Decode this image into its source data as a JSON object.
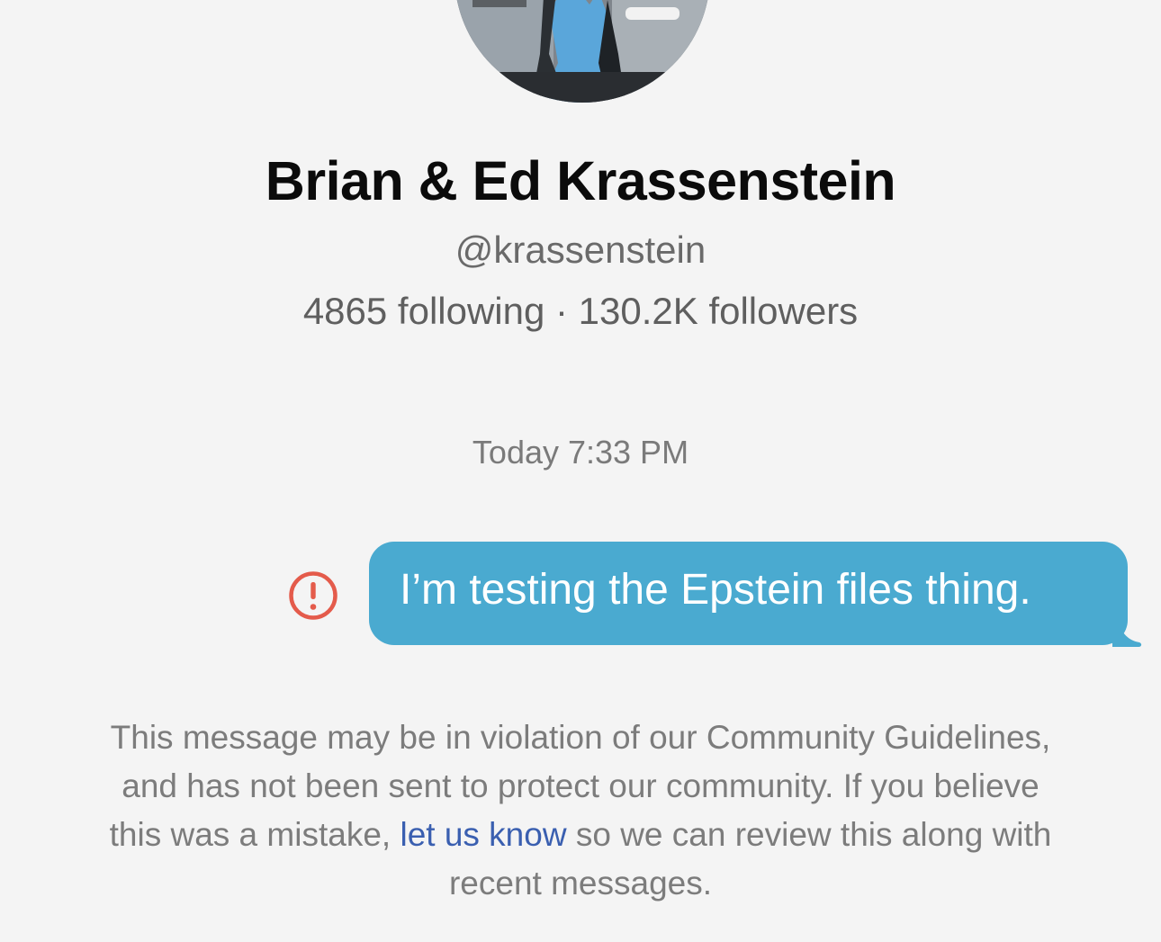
{
  "profile": {
    "display_name": "Brian & Ed Krassenstein",
    "handle": "@krassenstein",
    "stats": "4865 following · 130.2K followers"
  },
  "conversation": {
    "timestamp": "Today 7:33 PM",
    "message": {
      "text": "I’m testing the Epstein files thing.",
      "status_icon": "error-icon",
      "bubble_color": "#4aaad0",
      "error_color": "#e45b4b"
    }
  },
  "notice": {
    "text_before_link": "This message may be in violation of our Community Guidelines, and has not been sent to protect our community. If you believe this was a mistake, ",
    "link_text": "let us know",
    "text_after_link": " so we can review this along with recent messages.",
    "link_color": "#3a5fb0"
  }
}
